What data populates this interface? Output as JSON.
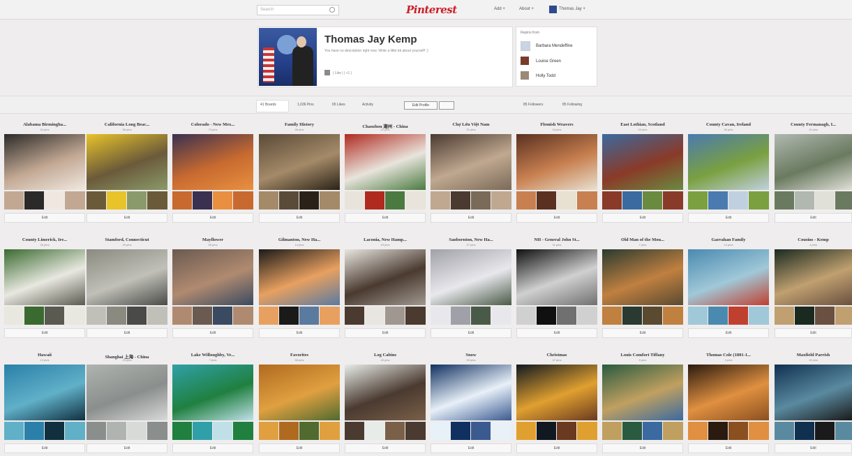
{
  "topbar": {
    "search_placeholder": "Search",
    "logo": "Pinterest",
    "add_label": "Add +",
    "about_label": "About +",
    "user_label": "Thomas Jay +"
  },
  "profile": {
    "name": "Thomas Jay Kemp",
    "description": "You have no description right now. Write a little bit about yourself! :)",
    "social": "| Like | | +1 |"
  },
  "repins": {
    "title": "Repins from",
    "users": [
      "Barbara Mendeffine",
      "Louise Green",
      "Holly Todd"
    ]
  },
  "tabs": {
    "boards": "41 Boards",
    "pins": "1,036 Pins",
    "likes": "65 Likes",
    "activity": "Activity",
    "edit_profile": "Edit Profile",
    "followers": "85 Followers",
    "following": "85 Following"
  },
  "edit_label": "Edit",
  "colors": {
    "brand": "#cb2027",
    "background": "#efeded"
  },
  "boards": [
    {
      "title": "Alabama Birmingha...",
      "count": "44 pins"
    },
    {
      "title": "California Long Beac...",
      "count": "36 pins"
    },
    {
      "title": "Colorado - New Mex...",
      "count": "73 pins"
    },
    {
      "title": "Family History",
      "count": "46 pins"
    },
    {
      "title": "Chaozhou 潮州 - China",
      "count": "22 pins"
    },
    {
      "title": "Chợ Lớn Việt Nam",
      "count": "21 pins"
    },
    {
      "title": "Flemish Weavers",
      "count": "18 pins"
    },
    {
      "title": "East Lothian, Scotland",
      "count": "20 pins"
    },
    {
      "title": "County Cavan, Ireland",
      "count": "50 pins"
    },
    {
      "title": "County Fermanagh, I...",
      "count": "19 pins"
    },
    {
      "title": "County Limerick, Ire...",
      "count": "26 pins"
    },
    {
      "title": "Stamford, Connecticut",
      "count": "29 pins"
    },
    {
      "title": "Mayflower",
      "count": "55 pins"
    },
    {
      "title": "Gilmanton, New Ha...",
      "count": "14 pins"
    },
    {
      "title": "Laconia, New Hamp...",
      "count": "29 pins"
    },
    {
      "title": "Sanbornton, New Ha...",
      "count": "27 pins"
    },
    {
      "title": "NH - General John St...",
      "count": "11 pins"
    },
    {
      "title": "Old Man of the Mou...",
      "count": "7 pins"
    },
    {
      "title": "Garrahan Family",
      "count": "12 pins"
    },
    {
      "title": "Cousins - Kemp",
      "count": "4 pins"
    },
    {
      "title": "Hawaii",
      "count": "12 pins"
    },
    {
      "title": "Shanghai 上海 - China",
      "count": "23 pins"
    },
    {
      "title": "Lake Willoughby, Ve...",
      "count": "7 pins"
    },
    {
      "title": "Favorites",
      "count": "58 pins"
    },
    {
      "title": "Log Cabins",
      "count": "49 pins"
    },
    {
      "title": "Snow",
      "count": "49 pins"
    },
    {
      "title": "Christmas",
      "count": "47 pins"
    },
    {
      "title": "Louis Comfort Tiffany",
      "count": "9 pins"
    },
    {
      "title": "Thomas Cole (1801-1...",
      "count": "4 pins"
    },
    {
      "title": "Maxfield Parrish",
      "count": "19 pins"
    }
  ]
}
